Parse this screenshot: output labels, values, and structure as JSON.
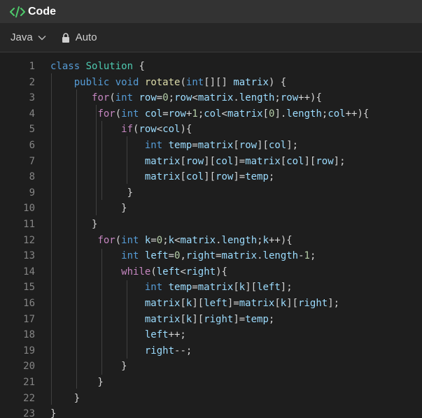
{
  "header": {
    "title": "Code",
    "icon": "code-icon",
    "accent": "#4ec96b"
  },
  "toolbar": {
    "language": "Java",
    "mode": "Auto"
  },
  "editor": {
    "lines": [
      {
        "n": "1",
        "tokens": [
          [
            "kw",
            "class"
          ],
          [
            "t",
            " "
          ],
          [
            "typ",
            "Solution"
          ],
          [
            "t",
            " {"
          ]
        ]
      },
      {
        "n": "2",
        "tokens": [
          [
            "t",
            "    "
          ],
          [
            "kw",
            "public"
          ],
          [
            "t",
            " "
          ],
          [
            "kw",
            "void"
          ],
          [
            "t",
            " "
          ],
          [
            "fn",
            "rotate"
          ],
          [
            "t",
            "("
          ],
          [
            "kw",
            "int"
          ],
          [
            "t",
            "[][] "
          ],
          [
            "var",
            "matrix"
          ],
          [
            "t",
            ") {"
          ]
        ]
      },
      {
        "n": "3",
        "tokens": [
          [
            "t",
            "       "
          ],
          [
            "ctl",
            "for"
          ],
          [
            "t",
            "("
          ],
          [
            "kw",
            "int"
          ],
          [
            "t",
            " "
          ],
          [
            "var",
            "row"
          ],
          [
            "t",
            "="
          ],
          [
            "num",
            "0"
          ],
          [
            "t",
            ";"
          ],
          [
            "var",
            "row"
          ],
          [
            "t",
            "<"
          ],
          [
            "var",
            "matrix"
          ],
          [
            "t",
            "."
          ],
          [
            "var",
            "length"
          ],
          [
            "t",
            ";"
          ],
          [
            "var",
            "row"
          ],
          [
            "t",
            "++){"
          ]
        ]
      },
      {
        "n": "4",
        "tokens": [
          [
            "t",
            "        "
          ],
          [
            "ctl",
            "for"
          ],
          [
            "t",
            "("
          ],
          [
            "kw",
            "int"
          ],
          [
            "t",
            " "
          ],
          [
            "var",
            "col"
          ],
          [
            "t",
            "="
          ],
          [
            "var",
            "row"
          ],
          [
            "t",
            "+"
          ],
          [
            "num",
            "1"
          ],
          [
            "t",
            ";"
          ],
          [
            "var",
            "col"
          ],
          [
            "t",
            "<"
          ],
          [
            "var",
            "matrix"
          ],
          [
            "t",
            "["
          ],
          [
            "num",
            "0"
          ],
          [
            "t",
            "]."
          ],
          [
            "var",
            "length"
          ],
          [
            "t",
            ";"
          ],
          [
            "var",
            "col"
          ],
          [
            "t",
            "++){"
          ]
        ]
      },
      {
        "n": "5",
        "tokens": [
          [
            "t",
            "            "
          ],
          [
            "ctl",
            "if"
          ],
          [
            "t",
            "("
          ],
          [
            "var",
            "row"
          ],
          [
            "t",
            "<"
          ],
          [
            "var",
            "col"
          ],
          [
            "t",
            "){"
          ]
        ]
      },
      {
        "n": "6",
        "tokens": [
          [
            "t",
            "                "
          ],
          [
            "kw",
            "int"
          ],
          [
            "t",
            " "
          ],
          [
            "var",
            "temp"
          ],
          [
            "t",
            "="
          ],
          [
            "var",
            "matrix"
          ],
          [
            "t",
            "["
          ],
          [
            "var",
            "row"
          ],
          [
            "t",
            "]["
          ],
          [
            "var",
            "col"
          ],
          [
            "t",
            "];"
          ]
        ]
      },
      {
        "n": "7",
        "tokens": [
          [
            "t",
            "                "
          ],
          [
            "var",
            "matrix"
          ],
          [
            "t",
            "["
          ],
          [
            "var",
            "row"
          ],
          [
            "t",
            "]["
          ],
          [
            "var",
            "col"
          ],
          [
            "t",
            "]="
          ],
          [
            "var",
            "matrix"
          ],
          [
            "t",
            "["
          ],
          [
            "var",
            "col"
          ],
          [
            "t",
            "]["
          ],
          [
            "var",
            "row"
          ],
          [
            "t",
            "];"
          ]
        ]
      },
      {
        "n": "8",
        "tokens": [
          [
            "t",
            "                "
          ],
          [
            "var",
            "matrix"
          ],
          [
            "t",
            "["
          ],
          [
            "var",
            "col"
          ],
          [
            "t",
            "]["
          ],
          [
            "var",
            "row"
          ],
          [
            "t",
            "]="
          ],
          [
            "var",
            "temp"
          ],
          [
            "t",
            ";"
          ]
        ]
      },
      {
        "n": "9",
        "tokens": [
          [
            "t",
            "             }"
          ]
        ]
      },
      {
        "n": "10",
        "tokens": [
          [
            "t",
            "            }"
          ]
        ]
      },
      {
        "n": "11",
        "tokens": [
          [
            "t",
            "       }"
          ]
        ]
      },
      {
        "n": "12",
        "tokens": [
          [
            "t",
            "        "
          ],
          [
            "ctl",
            "for"
          ],
          [
            "t",
            "("
          ],
          [
            "kw",
            "int"
          ],
          [
            "t",
            " "
          ],
          [
            "var",
            "k"
          ],
          [
            "t",
            "="
          ],
          [
            "num",
            "0"
          ],
          [
            "t",
            ";"
          ],
          [
            "var",
            "k"
          ],
          [
            "t",
            "<"
          ],
          [
            "var",
            "matrix"
          ],
          [
            "t",
            "."
          ],
          [
            "var",
            "length"
          ],
          [
            "t",
            ";"
          ],
          [
            "var",
            "k"
          ],
          [
            "t",
            "++){"
          ]
        ]
      },
      {
        "n": "13",
        "tokens": [
          [
            "t",
            "            "
          ],
          [
            "kw",
            "int"
          ],
          [
            "t",
            " "
          ],
          [
            "var",
            "left"
          ],
          [
            "t",
            "="
          ],
          [
            "num",
            "0"
          ],
          [
            "t",
            ","
          ],
          [
            "var",
            "right"
          ],
          [
            "t",
            "="
          ],
          [
            "var",
            "matrix"
          ],
          [
            "t",
            "."
          ],
          [
            "var",
            "length"
          ],
          [
            "t",
            "-"
          ],
          [
            "num",
            "1"
          ],
          [
            "t",
            ";"
          ]
        ]
      },
      {
        "n": "14",
        "tokens": [
          [
            "t",
            "            "
          ],
          [
            "ctl",
            "while"
          ],
          [
            "t",
            "("
          ],
          [
            "var",
            "left"
          ],
          [
            "t",
            "<"
          ],
          [
            "var",
            "right"
          ],
          [
            "t",
            "){"
          ]
        ]
      },
      {
        "n": "15",
        "tokens": [
          [
            "t",
            "                "
          ],
          [
            "kw",
            "int"
          ],
          [
            "t",
            " "
          ],
          [
            "var",
            "temp"
          ],
          [
            "t",
            "="
          ],
          [
            "var",
            "matrix"
          ],
          [
            "t",
            "["
          ],
          [
            "var",
            "k"
          ],
          [
            "t",
            "]["
          ],
          [
            "var",
            "left"
          ],
          [
            "t",
            "];"
          ]
        ]
      },
      {
        "n": "16",
        "tokens": [
          [
            "t",
            "                "
          ],
          [
            "var",
            "matrix"
          ],
          [
            "t",
            "["
          ],
          [
            "var",
            "k"
          ],
          [
            "t",
            "]["
          ],
          [
            "var",
            "left"
          ],
          [
            "t",
            "]="
          ],
          [
            "var",
            "matrix"
          ],
          [
            "t",
            "["
          ],
          [
            "var",
            "k"
          ],
          [
            "t",
            "]["
          ],
          [
            "var",
            "right"
          ],
          [
            "t",
            "];"
          ]
        ]
      },
      {
        "n": "17",
        "tokens": [
          [
            "t",
            "                "
          ],
          [
            "var",
            "matrix"
          ],
          [
            "t",
            "["
          ],
          [
            "var",
            "k"
          ],
          [
            "t",
            "]["
          ],
          [
            "var",
            "right"
          ],
          [
            "t",
            "]="
          ],
          [
            "var",
            "temp"
          ],
          [
            "t",
            ";"
          ]
        ]
      },
      {
        "n": "18",
        "tokens": [
          [
            "t",
            "                "
          ],
          [
            "var",
            "left"
          ],
          [
            "t",
            "++;"
          ]
        ]
      },
      {
        "n": "19",
        "tokens": [
          [
            "t",
            "                "
          ],
          [
            "var",
            "right"
          ],
          [
            "t",
            "--;"
          ]
        ]
      },
      {
        "n": "20",
        "tokens": [
          [
            "t",
            "            }"
          ]
        ]
      },
      {
        "n": "21",
        "tokens": [
          [
            "t",
            "        }"
          ]
        ]
      },
      {
        "n": "22",
        "tokens": [
          [
            "t",
            "    }"
          ]
        ]
      },
      {
        "n": "23",
        "tokens": [
          [
            "t",
            "}"
          ]
        ]
      }
    ]
  }
}
